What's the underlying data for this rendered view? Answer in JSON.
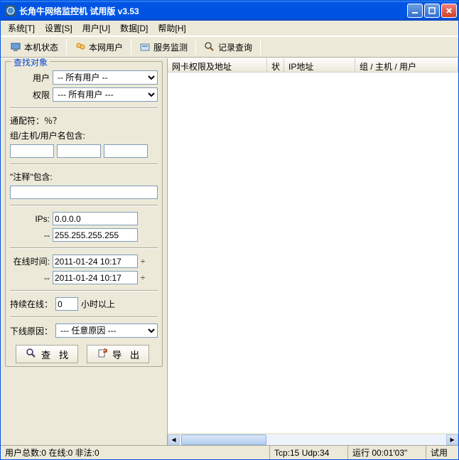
{
  "window": {
    "title": "长角牛网络监控机  试用版  v3.53"
  },
  "menu": {
    "items": [
      "系统[T]",
      "设置[S]",
      "用户[U]",
      "数据[D]",
      "帮助[H]"
    ]
  },
  "toolbar": {
    "items": [
      {
        "label": "本机状态"
      },
      {
        "label": "本网用户"
      },
      {
        "label": "服务监测"
      },
      {
        "label": "记录查询"
      }
    ]
  },
  "search": {
    "legend": "查找对象",
    "user_label": "用户",
    "user_select": "-- 所有用户 --",
    "perm_label": "权限",
    "perm_select": "--- 所有用户 ---",
    "wildcard_label": "通配符：％？",
    "group_label": "组/主机/用户名包含:",
    "group_v1": "",
    "group_v2": "",
    "group_v3": "",
    "comment_label": "\"注释\"包含:",
    "comment_value": "",
    "ips_label": "IPs:",
    "ip_from": "0.0.0.0",
    "ip_dash": "--",
    "ip_to": "255.255.255.255",
    "online_label": "在线时间:",
    "online_from": "2011-01-24 10:17",
    "online_dash": "--",
    "online_to": "2011-01-24 10:17",
    "persist_label": "持续在线：",
    "persist_value": "0",
    "persist_suffix": "小时以上",
    "offline_label": "下线原因：",
    "offline_select": "--- 任意原因 ---",
    "find_btn": "查 找",
    "export_btn": "导 出"
  },
  "list": {
    "columns": [
      "网卡权限及地址",
      "状",
      "IP地址",
      "组 / 主机 / 用户"
    ]
  },
  "status": {
    "users": "用户总数:0 在线:0 非法:0",
    "tcpudp": "Tcp:15 Udp:34",
    "runtime": "运行 00:01'03\"",
    "trial": "试用"
  }
}
